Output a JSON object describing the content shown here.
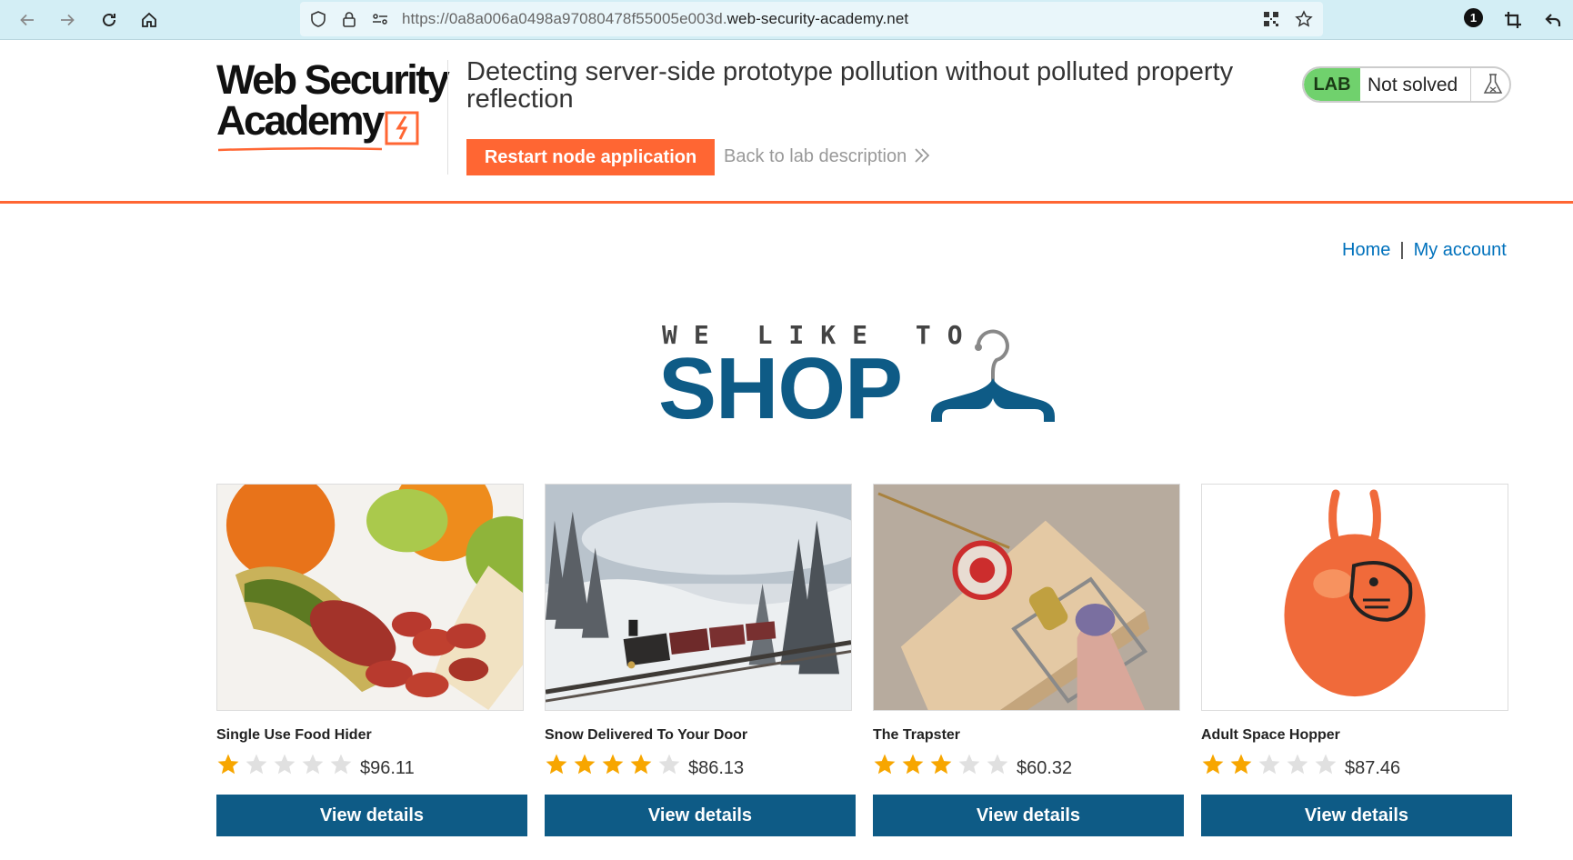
{
  "browser": {
    "url_dim": "https://0a8a006a0498a97080478f55005e003d.",
    "url_main": "web-security-academy.net",
    "notification_count": "1"
  },
  "lab_header": {
    "logo_line1": "Web Security",
    "logo_line2": "Academy",
    "title": "Detecting server-side prototype pollution without polluted property reflection",
    "restart_button": "Restart node application",
    "back_link": "Back to lab description",
    "lab_tag": "LAB",
    "status": "Not solved"
  },
  "nav": {
    "home": "Home",
    "separator": "|",
    "account": "My account"
  },
  "banner": {
    "small": "WE LIKE TO",
    "big": "SHOP"
  },
  "products": [
    {
      "name": "Single Use Food Hider",
      "rating": 1,
      "price": "$96.11",
      "button": "View details",
      "image": "food-hider-image"
    },
    {
      "name": "Snow Delivered To Your Door",
      "rating": 4,
      "price": "$86.13",
      "button": "View details",
      "image": "snow-train-image"
    },
    {
      "name": "The Trapster",
      "rating": 3,
      "price": "$60.32",
      "button": "View details",
      "image": "mousetrap-image"
    },
    {
      "name": "Adult Space Hopper",
      "rating": 2,
      "price": "$87.46",
      "button": "View details",
      "image": "space-hopper-image"
    }
  ],
  "colors": {
    "accent": "#ff6633",
    "primary": "#0e5b86",
    "link": "#0071bc",
    "star_filled": "#f7a600",
    "star_empty": "#e0e0e0",
    "lab_green": "#70d16d"
  }
}
